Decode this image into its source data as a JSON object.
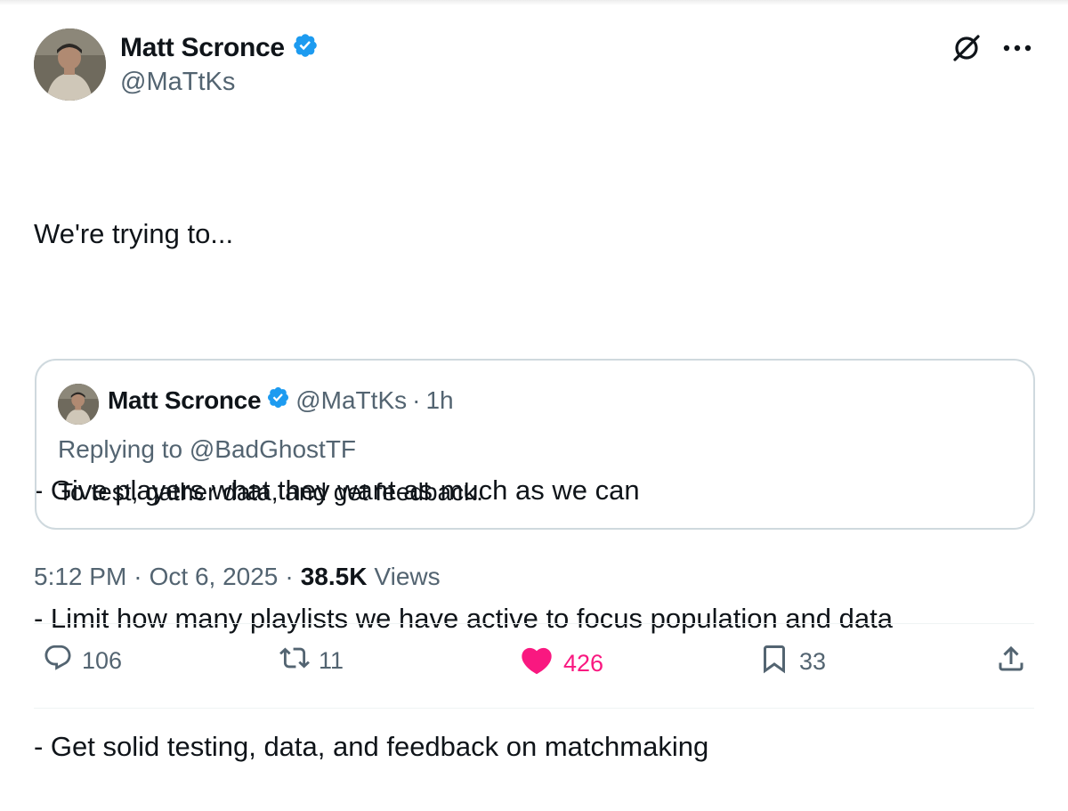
{
  "author": {
    "display_name": "Matt Scronce",
    "handle": "@MaTtKs",
    "verified": true,
    "verified_color": "#1d9bf0"
  },
  "tweet": {
    "lines": [
      "We're trying to...",
      "",
      "- Give players what they want as much as we can",
      "- Limit how many playlists we have active to focus population and data",
      "- Get solid testing, data, and feedback on matchmaking"
    ]
  },
  "quoted": {
    "display_name": "Matt Scronce",
    "handle": "@MaTtKs",
    "separator": "·",
    "time": "1h",
    "replying_prefix": "Replying to ",
    "replying_to": "@BadGhostTF",
    "text": "To test, gather data, and get feedback."
  },
  "meta": {
    "time": "5:12 PM",
    "date": "Oct 6, 2025",
    "separator": "·",
    "views_count": "38.5K",
    "views_label": "Views"
  },
  "actions": {
    "replies": "106",
    "reposts": "11",
    "likes": "426",
    "bookmarks": "33"
  },
  "icons": {
    "grok": "grok-icon",
    "more": "more-icon",
    "reply": "reply-icon",
    "repost": "repost-icon",
    "like": "heart-icon",
    "bookmark": "bookmark-icon",
    "share": "share-icon"
  },
  "colors": {
    "text": "#0f1419",
    "secondary": "#536471",
    "like": "#f91880",
    "border": "#cfd9de"
  }
}
